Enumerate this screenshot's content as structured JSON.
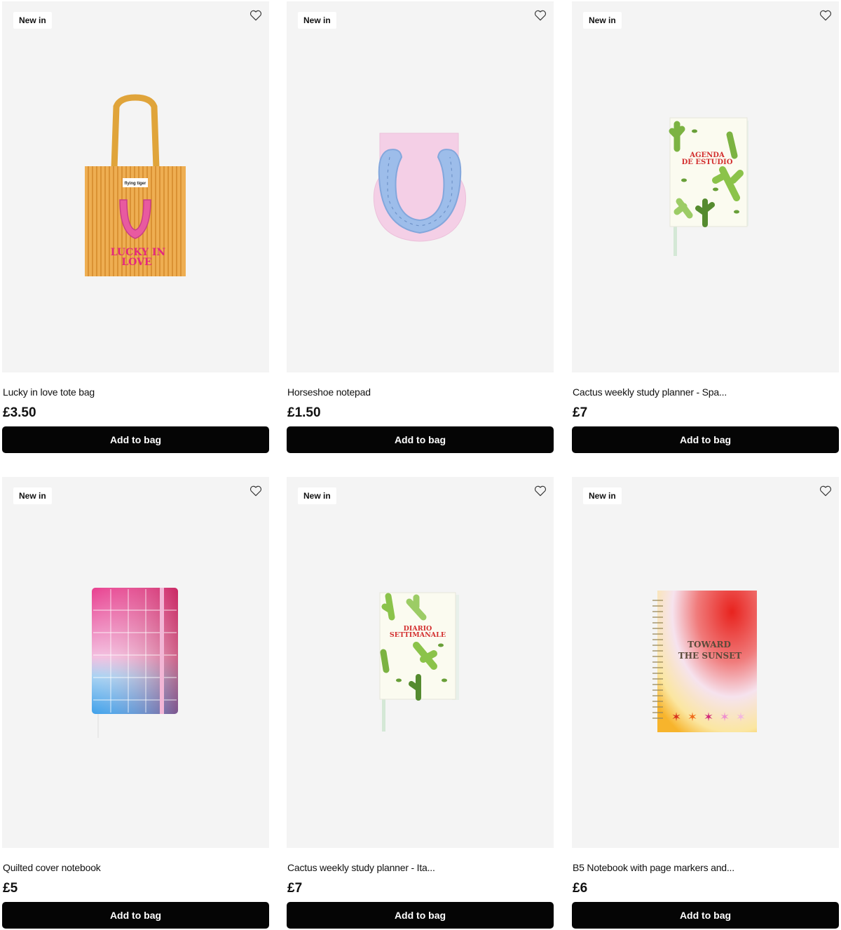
{
  "products": [
    {
      "badge": "New in",
      "title": "Lucky in love tote bag",
      "price": "£3.50",
      "cta": "Add to bag",
      "art_text": [
        "flying tiger",
        "LUCKY IN",
        "LOVE"
      ]
    },
    {
      "badge": "New in",
      "title": "Horseshoe notepad",
      "price": "£1.50",
      "cta": "Add to bag",
      "art_text": []
    },
    {
      "badge": "New in",
      "title": "Cactus weekly study planner - Spa...",
      "price": "£7",
      "cta": "Add to bag",
      "art_text": [
        "AGENDA",
        "DE ESTUDIO"
      ]
    },
    {
      "badge": "New in",
      "title": "Quilted cover notebook",
      "price": "£5",
      "cta": "Add to bag",
      "art_text": []
    },
    {
      "badge": "New in",
      "title": "Cactus weekly study planner - Ita...",
      "price": "£7",
      "cta": "Add to bag",
      "art_text": [
        "DIARIO",
        "SETTIMANALE"
      ]
    },
    {
      "badge": "New in",
      "title": "B5 Notebook with page markers and...",
      "price": "£6",
      "cta": "Add to bag",
      "art_text": [
        "TOWARD",
        "THE SUNSET"
      ]
    }
  ],
  "colors": {
    "button_bg": "#050505",
    "image_bg": "#f4f4f4",
    "badge_bg": "#ffffff"
  },
  "icons": {
    "wishlist": "heart-outline-icon"
  }
}
